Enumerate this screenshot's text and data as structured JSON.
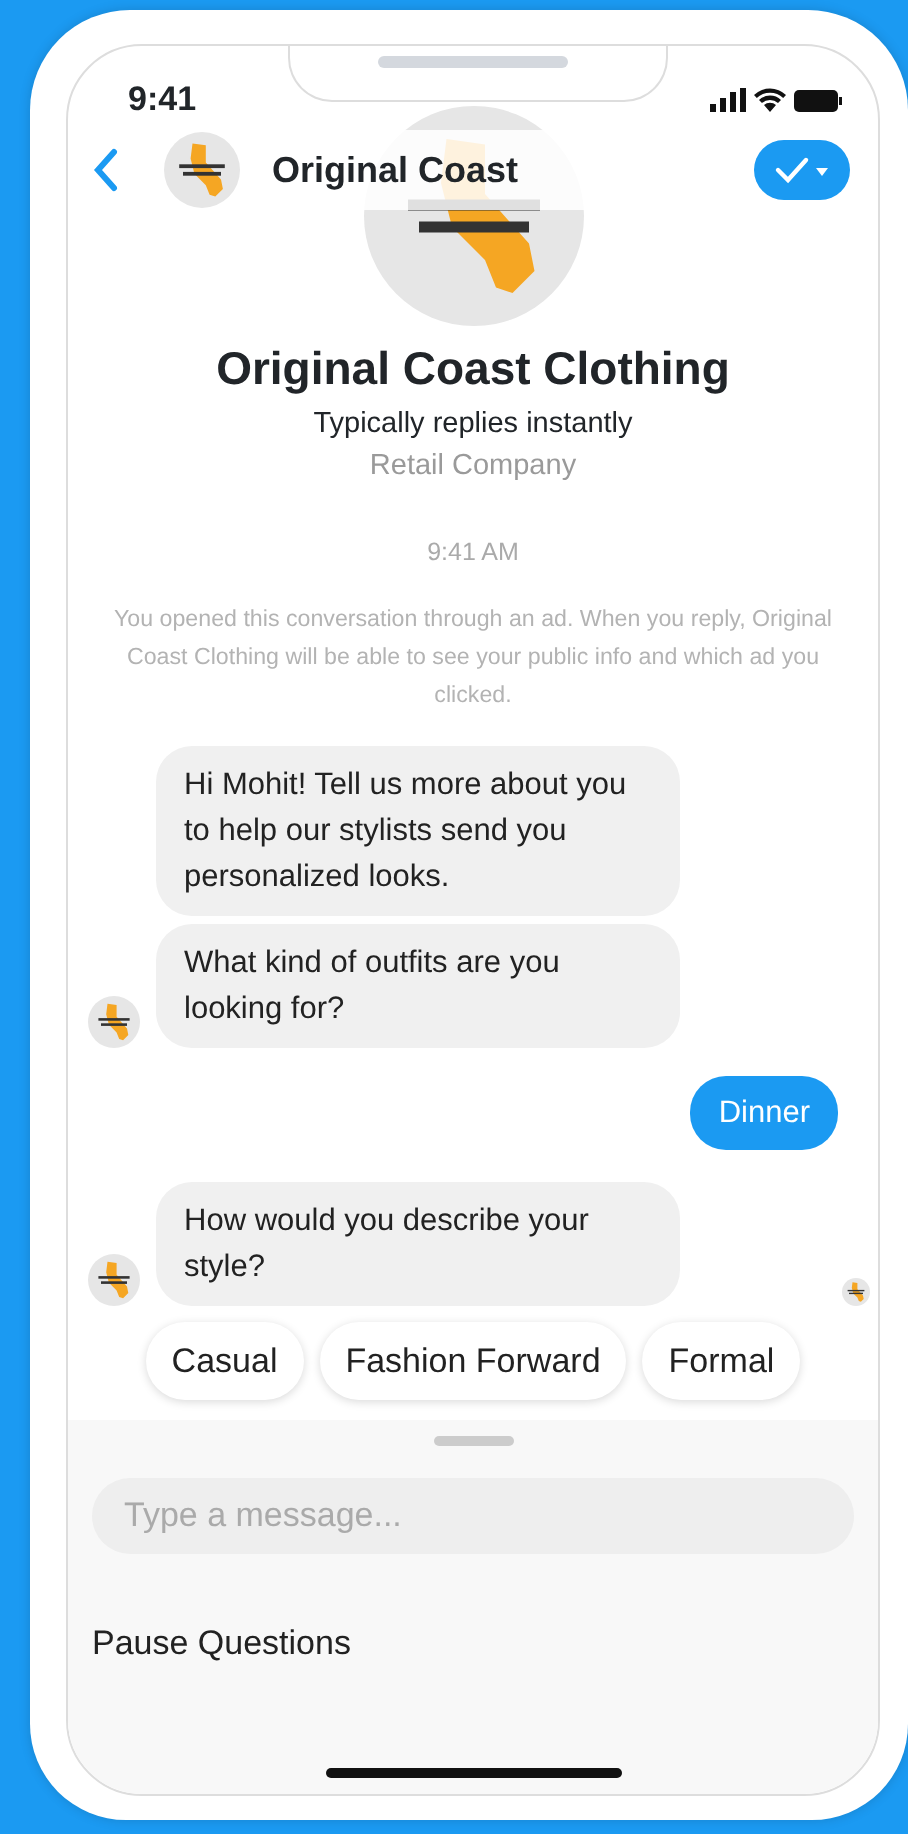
{
  "status_bar": {
    "time": "9:41"
  },
  "header": {
    "title": "Original Coast"
  },
  "profile": {
    "name": "Original Coast Clothing",
    "response_time": "Typically replies instantly",
    "category": "Retail Company"
  },
  "timestamp": "9:41 AM",
  "notice": "You opened this conversation through an ad. When you reply, Original Coast Clothing will be able to see your public info and which ad you clicked.",
  "messages": [
    {
      "kind": "incoming",
      "text": "Hi Mohit! Tell us more about you to help our stylists send you personalized looks.",
      "avatar": false
    },
    {
      "kind": "incoming",
      "text": "What kind of outfits are you looking for?",
      "avatar": true
    },
    {
      "kind": "outgoing",
      "text": "Dinner"
    },
    {
      "kind": "incoming",
      "text": "How would you describe your style?",
      "avatar": true
    }
  ],
  "seen": true,
  "quick_replies": [
    "Casual",
    "Fashion Forward",
    "Formal"
  ],
  "composer": {
    "placeholder": "Type a message..."
  },
  "menu": [
    "Pause Questions"
  ]
}
